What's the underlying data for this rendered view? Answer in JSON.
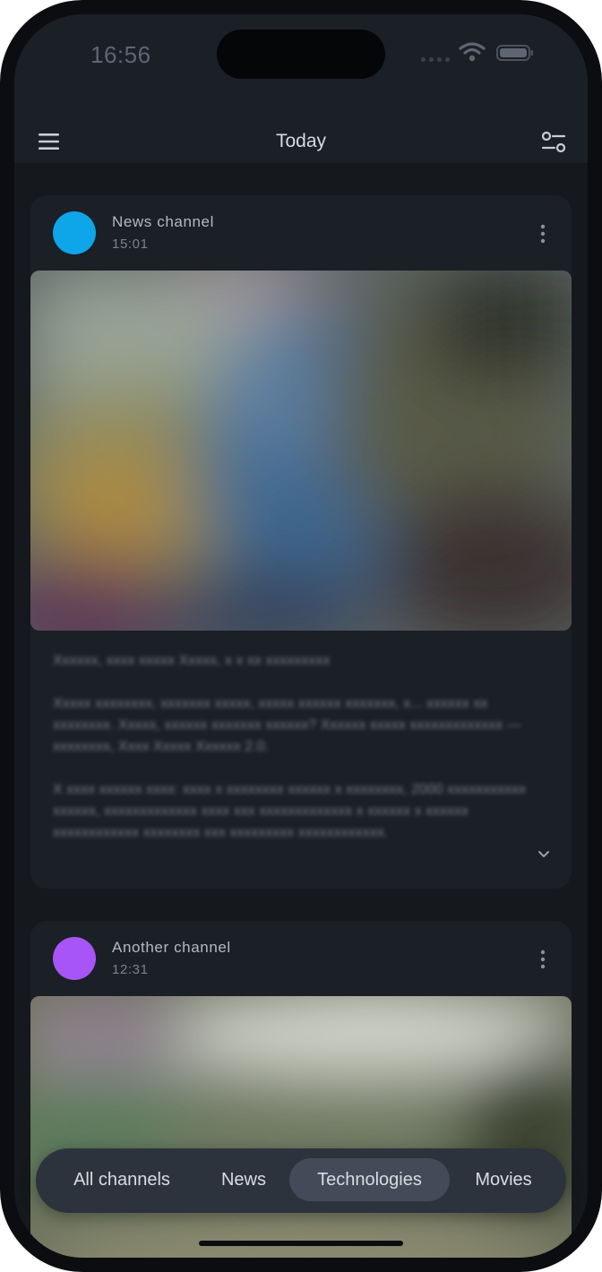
{
  "status_bar": {
    "time": "16:56",
    "icons": [
      "signal-icon",
      "wifi-icon",
      "battery-icon"
    ]
  },
  "header": {
    "title": "Today",
    "left_icon": "menu-icon",
    "right_icon": "filter-settings-icon"
  },
  "posts": [
    {
      "channel": "News channel",
      "time": "15:01",
      "avatar_color": "#0ea5e9",
      "image": "blurred-photo",
      "paragraphs": [
        "Xxxxxx, xxxx xxxxx Xxxxx, x x xx xxxxxxxxx",
        "Xxxxx xxxxxxxx, xxxxxxx xxxxx, xxxxx xxxxxx xxxxxxx, x... xxxxxx xx xxxxxxxx. Xxxxx, xxxxxx xxxxxxx xxxxxx? Xxxxxx xxxxx xxxxxxxxxxxxx — xxxxxxxx, Xxxx Xxxxx Xxxxxx 2.0.",
        "X xxxx xxxxxx xxxx: xxxx x xxxxxxxx xxxxxx x xxxxxxxx, 2000 xxxxxxxxxxx xxxxxx, xxxxxxxxxxxxx xxxx xxx xxxxxxxxxxxxx x xxxxxx x xxxxxx xxxxxxxxxxxx xxxxxxxx xxx xxxxxxxxx xxxxxxxxxxxx."
      ],
      "more_icon": "more-vertical-icon",
      "expand_icon": "chevron-down-icon"
    },
    {
      "channel": "Another channel",
      "time": "12:31",
      "avatar_color": "#a855f7",
      "image": "blurred-photo",
      "more_icon": "more-vertical-icon"
    }
  ],
  "tabs": [
    {
      "label": "All channels",
      "active": false
    },
    {
      "label": "News",
      "active": false
    },
    {
      "label": "Technologies",
      "active": true
    },
    {
      "label": "Movies",
      "active": false
    }
  ],
  "colors": {
    "background": "#15181d",
    "surface": "#1b1f26",
    "tabbar": "#2d333d",
    "tab_active": "#434b58"
  }
}
